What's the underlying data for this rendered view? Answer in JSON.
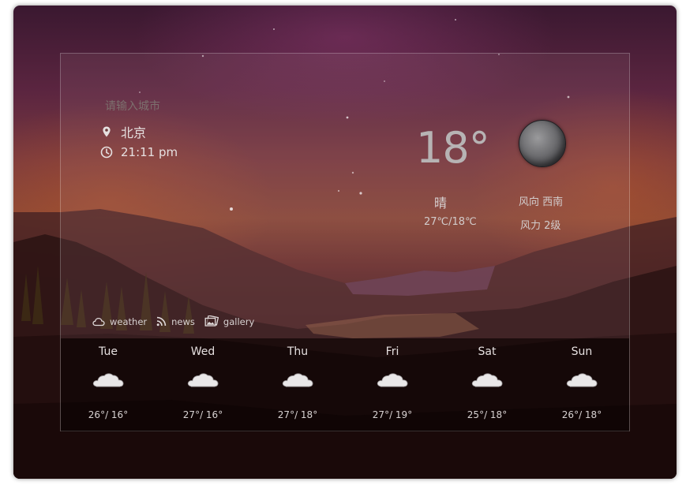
{
  "search": {
    "placeholder": "请输入城市"
  },
  "current": {
    "city": "北京",
    "time": "21:11 pm",
    "temperature": "18°",
    "condition": "晴",
    "temp_range": "27℃/18℃",
    "wind_direction": "风向 西南",
    "wind_level": "风力 2级",
    "icon": "moon-icon"
  },
  "nav": {
    "items": [
      {
        "label": "weather",
        "icon": "cloud-icon"
      },
      {
        "label": "news",
        "icon": "rss-icon"
      },
      {
        "label": "gallery",
        "icon": "gallery-icon"
      }
    ]
  },
  "forecast": [
    {
      "day": "Tue",
      "temps": "26°/ 16°",
      "icon": "cloud-icon"
    },
    {
      "day": "Wed",
      "temps": "27°/ 16°",
      "icon": "cloud-icon"
    },
    {
      "day": "Thu",
      "temps": "27°/ 18°",
      "icon": "cloud-icon"
    },
    {
      "day": "Fri",
      "temps": "27°/ 19°",
      "icon": "cloud-icon"
    },
    {
      "day": "Sat",
      "temps": "25°/ 18°",
      "icon": "cloud-icon"
    },
    {
      "day": "Sun",
      "temps": "26°/ 18°",
      "icon": "cloud-icon"
    }
  ],
  "colors": {
    "text_primary": "#e6e0e0",
    "temperature": "#b7b3b4",
    "panel_border": "#ffffff"
  }
}
